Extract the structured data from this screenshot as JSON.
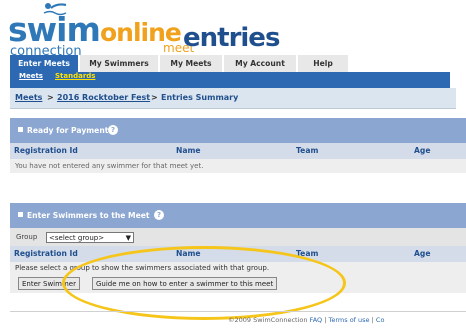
{
  "brand": {
    "swim": "swim",
    "online": "online",
    "meet": "meet",
    "entries": "entries",
    "connection": "connection"
  },
  "tabs": [
    {
      "label": "Enter Meets",
      "active": true
    },
    {
      "label": "My Swimmers",
      "active": false
    },
    {
      "label": "My Meets",
      "active": false
    },
    {
      "label": "My Account",
      "active": false
    },
    {
      "label": "Help",
      "active": false
    }
  ],
  "subnav": {
    "meets": "Meets",
    "standards": "Standards"
  },
  "breadcrumb": {
    "meets": "Meets",
    "sep1": ">",
    "meet_name": "2016 Rocktober Fest",
    "sep2": ">",
    "current": "Entries Summary"
  },
  "ready_panel": {
    "title": "Ready for Payment",
    "help": "?",
    "columns": [
      "Registration Id",
      "Name",
      "Team",
      "Age"
    ],
    "message": "You have not entered any swimmer for that meet yet."
  },
  "enter_panel": {
    "title": "Enter Swimmers to the Meet",
    "help": "?",
    "group_label": "Group",
    "group_select": "<select group>",
    "columns": [
      "Registration Id",
      "Name",
      "Team",
      "Age"
    ],
    "message": "Please select a group to show the swimmers associated with that group.",
    "enter_button": "Enter Swimmer",
    "guide_button": "Guide me on how to enter a swimmer to this meet"
  },
  "footer": {
    "copyright": "©2009 SwimConnection",
    "faq": "FAQ",
    "sep": "|",
    "terms": "Terms of use",
    "contact": "Co"
  },
  "colors": {
    "accent": "#2d69b2",
    "panel_header": "#8ba6d1",
    "highlight": "#f6c51a",
    "brand_orange": "#f0a21c"
  }
}
